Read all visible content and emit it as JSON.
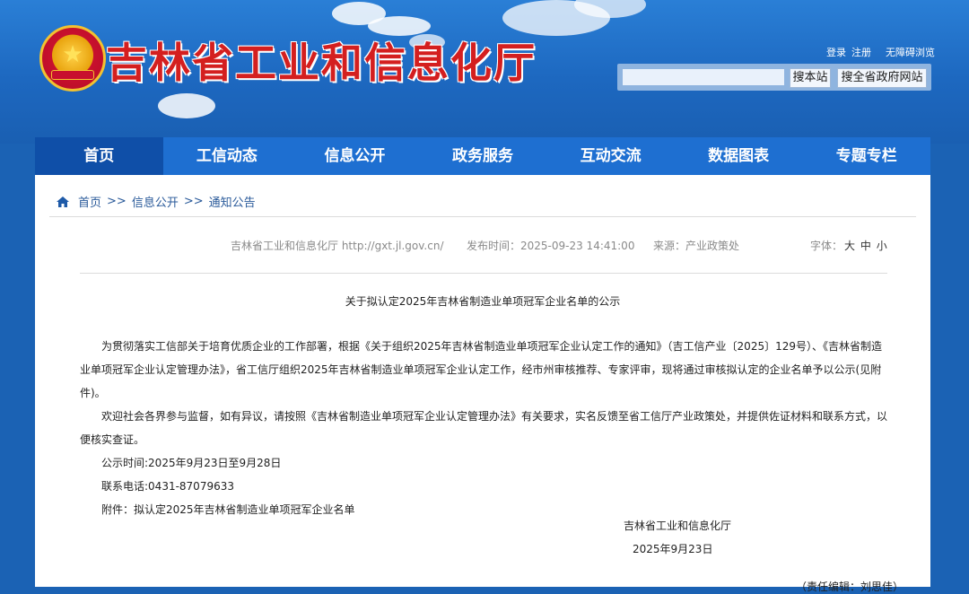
{
  "header": {
    "site_title": "吉林省工业和信息化厅",
    "top_links": [
      "登录",
      "注册",
      "无障碍浏览"
    ],
    "search": {
      "placeholder": "",
      "btn_site": "搜本站",
      "btn_all": "搜全省政府网站"
    }
  },
  "nav": {
    "items": [
      "首页",
      "工信动态",
      "信息公开",
      "政务服务",
      "互动交流",
      "数据图表",
      "专题专栏"
    ]
  },
  "breadcrumb": {
    "items": [
      "首页",
      "信息公开",
      "通知公告"
    ],
    "sep": ">>"
  },
  "meta": {
    "source": "吉林省工业和信息化厅 http://gxt.jl.gov.cn/",
    "publish_time": "发布时间：2025-09-23 14:41:00",
    "from": "来源：产业政策处",
    "font_label": "字体：",
    "font_sizes": [
      "大",
      "中",
      "小"
    ]
  },
  "article": {
    "title": "关于拟认定2025年吉林省制造业单项冠军企业名单的公示",
    "p1": "为贯彻落实工信部关于培育优质企业的工作部署，根据《关于组织2025年吉林省制造业单项冠军企业认定工作的通知》（吉工信产业〔2025〕129号）、《吉林省制造业单项冠军企业认定管理办法》，省工信厅组织2025年吉林省制造业单项冠军企业认定工作，经市州审核推荐、专家评审，现将通过审核拟认定的企业名单予以公示(见附件)。",
    "p2": "欢迎社会各界参与监督，如有异议，请按照《吉林省制造业单项冠军企业认定管理办法》有关要求，实名反馈至省工信厅产业政策处，并提供佐证材料和联系方式，以便核实查证。",
    "p3": "公示时间:2025年9月23日至9月28日",
    "p4": "联系电话:0431-87079633",
    "p5": "附件：拟认定2025年吉林省制造业单项冠军企业名单",
    "sign_org": "吉林省工业和信息化厅",
    "sign_date": "2025年9月23日",
    "editor": "（责任编辑：刘思佳）"
  },
  "colors": {
    "header_blue": "#1d68c0",
    "nav_blue": "#1e6fd1",
    "nav_active": "#0f4fa8",
    "title_red": "#d41f1f"
  }
}
